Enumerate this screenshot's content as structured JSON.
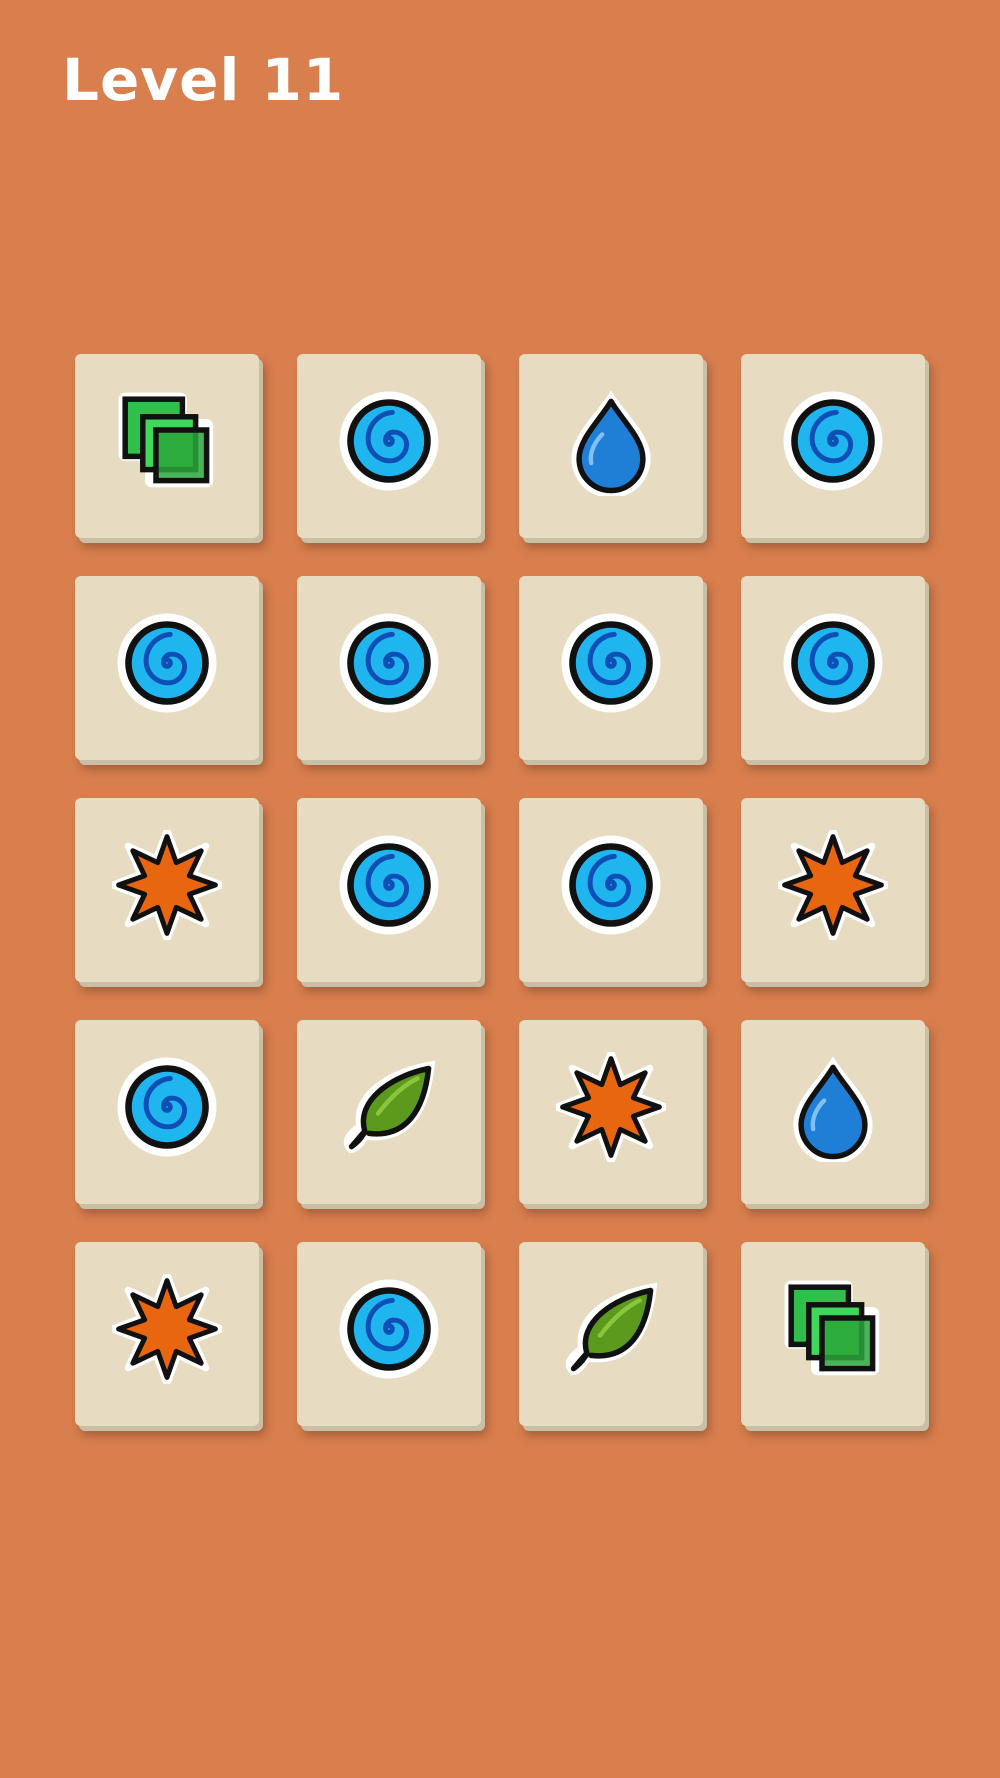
{
  "header": {
    "level_label": "Level 11"
  },
  "board": {
    "rows": 5,
    "cols": 4,
    "tiles": [
      [
        "squares-icon",
        "spiral-icon",
        "drop-icon",
        "spiral-icon"
      ],
      [
        "spiral-icon",
        "spiral-icon",
        "spiral-icon",
        "spiral-icon"
      ],
      [
        "burst-icon",
        "spiral-icon",
        "spiral-icon",
        "burst-icon"
      ],
      [
        "spiral-icon",
        "leaf-icon",
        "burst-icon",
        "drop-icon"
      ],
      [
        "burst-icon",
        "spiral-icon",
        "leaf-icon",
        "squares-icon"
      ]
    ]
  },
  "colors": {
    "background": "#d97e4d",
    "tile": "#e7dcc1",
    "spiral": "#1fb6ef",
    "drop": "#1f7fd6",
    "burst": "#e8660f",
    "leaf": "#5b9a1c",
    "squares": "#2fbf4a"
  }
}
